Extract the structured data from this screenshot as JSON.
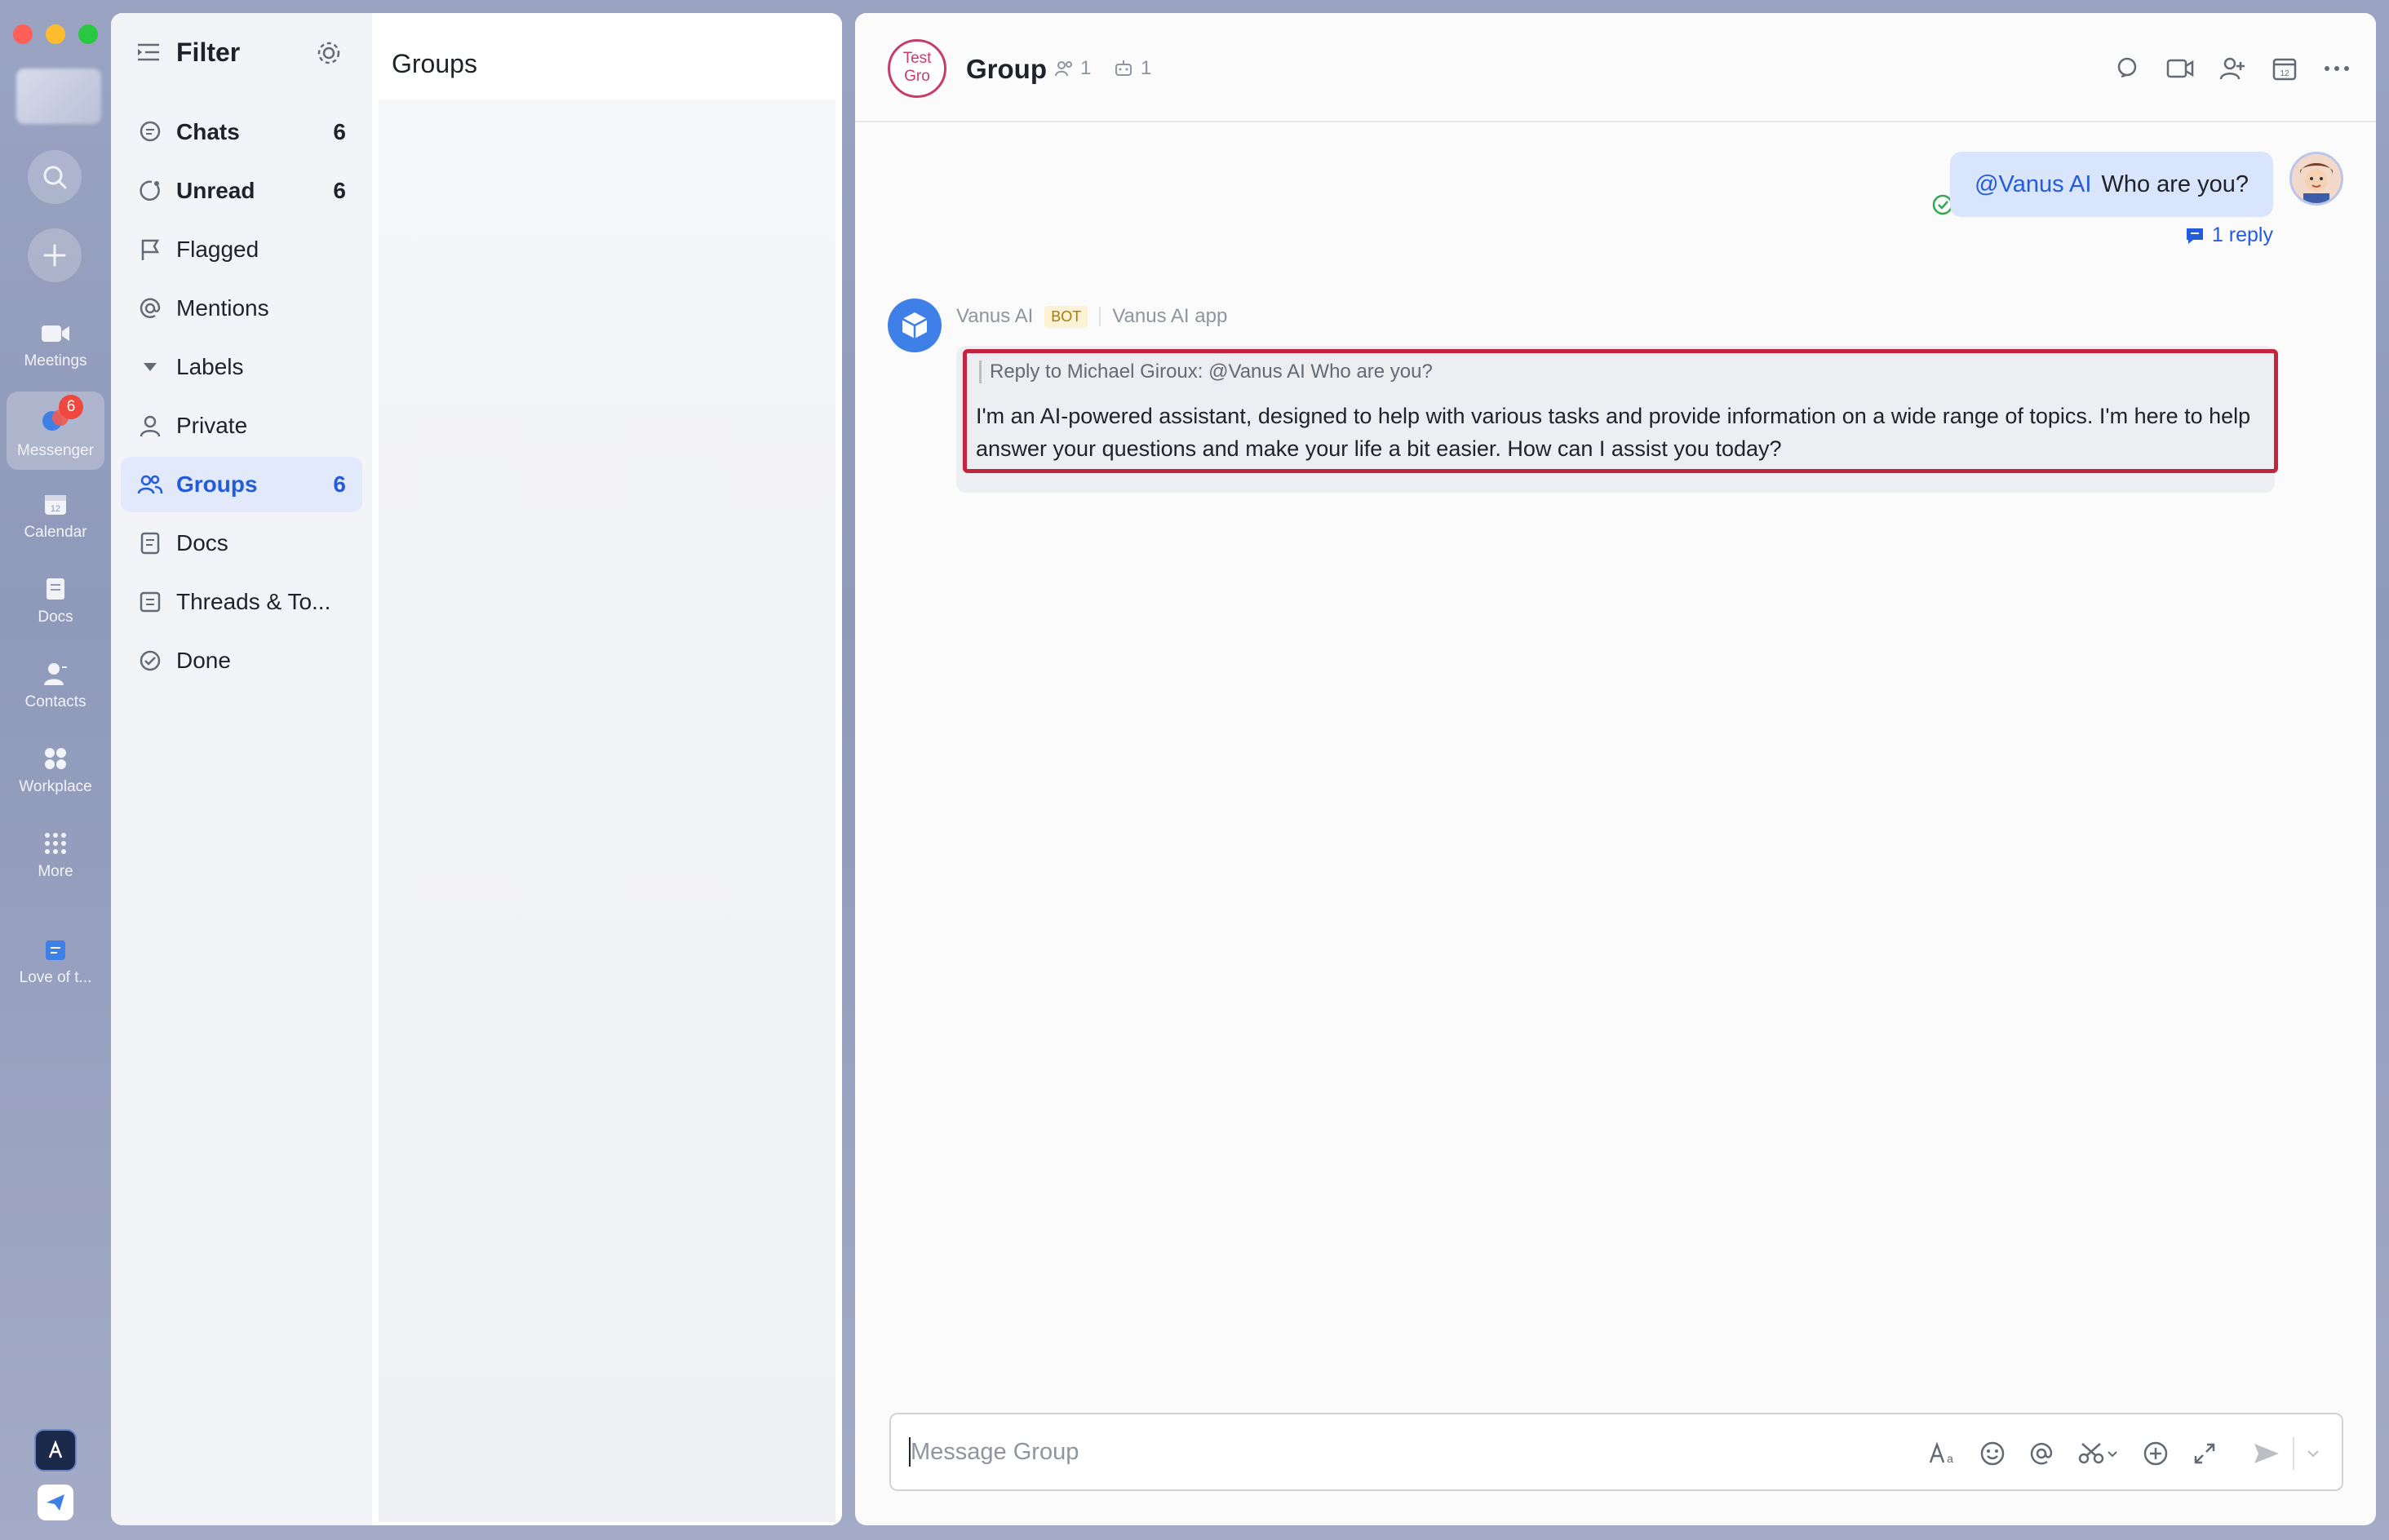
{
  "window": {
    "traffic_lights": {
      "close": "#fe5f57",
      "minimize": "#febc2e",
      "zoom": "#28c840"
    }
  },
  "rail": {
    "items": [
      {
        "label": "Meetings",
        "icon": "video-icon"
      },
      {
        "label": "Messenger",
        "icon": "messenger-icon",
        "badge": "6"
      },
      {
        "label": "Calendar",
        "icon": "calendar-icon"
      },
      {
        "label": "Docs",
        "icon": "docs-icon"
      },
      {
        "label": "Contacts",
        "icon": "contacts-icon"
      },
      {
        "label": "Workplace",
        "icon": "workplace-icon"
      },
      {
        "label": "More",
        "icon": "more-icon"
      },
      {
        "label": "Love of t...",
        "icon": "document-shortcut-icon"
      }
    ]
  },
  "filter": {
    "title": "Filter",
    "items": [
      {
        "label": "Chats",
        "count": "6",
        "icon": "chat-bubble-icon"
      },
      {
        "label": "Unread",
        "count": "6",
        "icon": "unread-icon"
      },
      {
        "label": "Flagged",
        "count": "",
        "icon": "flag-icon"
      },
      {
        "label": "Mentions",
        "count": "",
        "icon": "at-icon"
      },
      {
        "label": "Labels",
        "count": "",
        "icon": "caret-down-icon"
      },
      {
        "label": "Private",
        "count": "",
        "icon": "person-icon"
      },
      {
        "label": "Groups",
        "count": "6",
        "icon": "group-icon"
      },
      {
        "label": "Docs",
        "count": "",
        "icon": "doc-icon"
      },
      {
        "label": "Threads & To...",
        "count": "",
        "icon": "threads-icon"
      },
      {
        "label": "Done",
        "count": "",
        "icon": "check-circle-icon"
      }
    ]
  },
  "groups_panel": {
    "title": "Groups"
  },
  "chat": {
    "group_avatar_text_line1": "Test",
    "group_avatar_text_line2": "Gro",
    "name": "Group",
    "member_count": "1",
    "bot_count": "1",
    "messages": {
      "me": {
        "mention": "@Vanus AI",
        "text": "Who are you?",
        "reply_count": "1 reply"
      },
      "bot": {
        "sender": "Vanus AI",
        "badge": "BOT",
        "app": "Vanus AI app",
        "quote": "Reply to Michael Giroux:  @Vanus AI Who are you?",
        "text": "I'm an AI-powered assistant, designed to help with various tasks and provide information on a wide range of topics. I'm here to help answer your questions and make your life a bit easier. How can I assist you today?"
      }
    },
    "input_placeholder": "Message Group"
  },
  "colors": {
    "accent": "#245bdb",
    "active_filter_bg": "#e1e9fb",
    "highlight_border": "#c4253e",
    "group_avatar": "#c83c6b",
    "bot_avatar": "#3f7fe8"
  }
}
